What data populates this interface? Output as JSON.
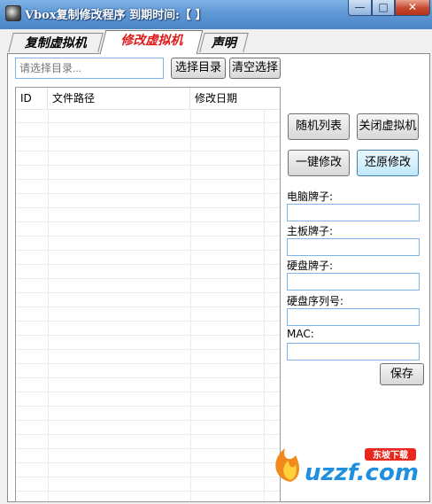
{
  "window": {
    "title": "Vbox复制修改程序  到期时间:【 】",
    "min_label": "—",
    "max_label": "□",
    "close_label": "✕"
  },
  "tabs": [
    {
      "label": "复制虚拟机",
      "active": false
    },
    {
      "label": "修改虚拟机",
      "active": true
    },
    {
      "label": "声明",
      "active": false
    }
  ],
  "toolbar": {
    "dir_placeholder": "请选择目录...",
    "select_dir_label": "选择目录",
    "clear_label": "清空选择"
  },
  "list": {
    "columns": [
      "ID",
      "文件路径",
      "修改日期"
    ],
    "rows": []
  },
  "actions": {
    "random_list_label": "随机列表",
    "close_vm_label": "关闭虚拟机",
    "one_key_label": "一键修改",
    "restore_label": "还原修改"
  },
  "fields": [
    {
      "label": "电脑牌子:",
      "value": ""
    },
    {
      "label": "主板牌子:",
      "value": ""
    },
    {
      "label": "硬盘牌子:",
      "value": ""
    },
    {
      "label": "硬盘序列号:",
      "value": ""
    },
    {
      "label": "MAC:",
      "value": ""
    }
  ],
  "save_label": "保存",
  "watermark": {
    "text": "uzzf.com",
    "badge": "东坡下载"
  },
  "colors": {
    "active_tab": "#e01a1a",
    "titlebar": "#5f98d6",
    "input_border": "#7eb4ea"
  }
}
